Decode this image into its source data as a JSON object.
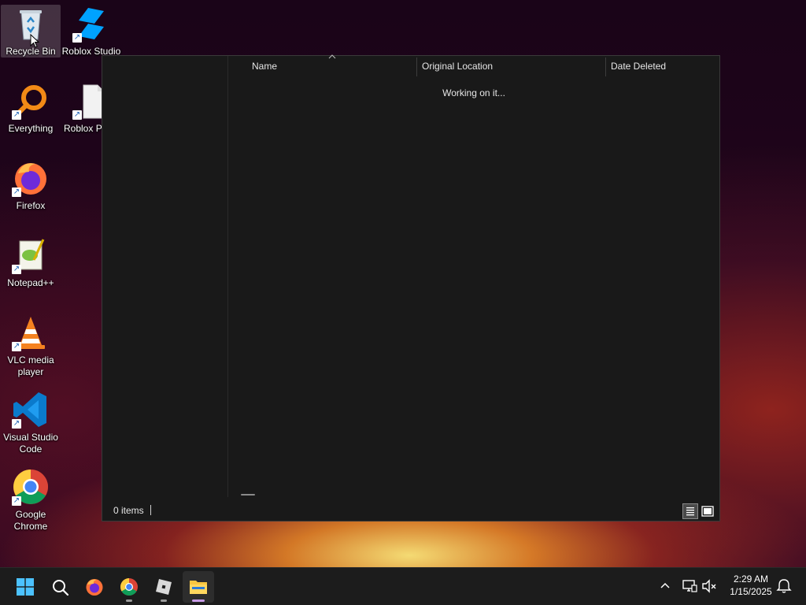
{
  "desktop": {
    "icons": [
      {
        "label": "Recycle Bin",
        "icon": "recycle-bin-icon",
        "selected": true
      },
      {
        "label": "Roblox Studio",
        "icon": "roblox-studio-icon"
      },
      {
        "label": "Everything",
        "icon": "everything-search-icon"
      },
      {
        "label": "Roblox Pl",
        "icon": "roblox-player-icon"
      },
      {
        "label": "Firefox",
        "icon": "firefox-icon"
      },
      {
        "label": "Notepad++",
        "icon": "notepadpp-icon"
      },
      {
        "label": "VLC media player",
        "icon": "vlc-icon"
      },
      {
        "label": "Visual Studio Code",
        "icon": "vscode-icon"
      },
      {
        "label": "Google Chrome",
        "icon": "chrome-icon"
      }
    ]
  },
  "explorer": {
    "columns": [
      "Name",
      "Original Location",
      "Date Deleted"
    ],
    "sort_column": "Name",
    "loading_text": "Working on it...",
    "status": {
      "item_count": "0 items"
    }
  },
  "taskbar": {
    "apps": [
      {
        "name": "start-button",
        "icon": "windows-logo-icon"
      },
      {
        "name": "search-button",
        "icon": "search-icon"
      },
      {
        "name": "firefox",
        "icon": "firefox-icon"
      },
      {
        "name": "chrome",
        "icon": "chrome-icon"
      },
      {
        "name": "roblox",
        "icon": "roblox-icon"
      },
      {
        "name": "file-explorer",
        "icon": "folder-icon",
        "active": true
      }
    ],
    "clock": {
      "time": "2:29 AM",
      "date": "1/15/2025"
    }
  },
  "colors": {
    "accent": "#c79be6",
    "window_bg": "#191919",
    "taskbar_bg": "#1c1c1c"
  }
}
